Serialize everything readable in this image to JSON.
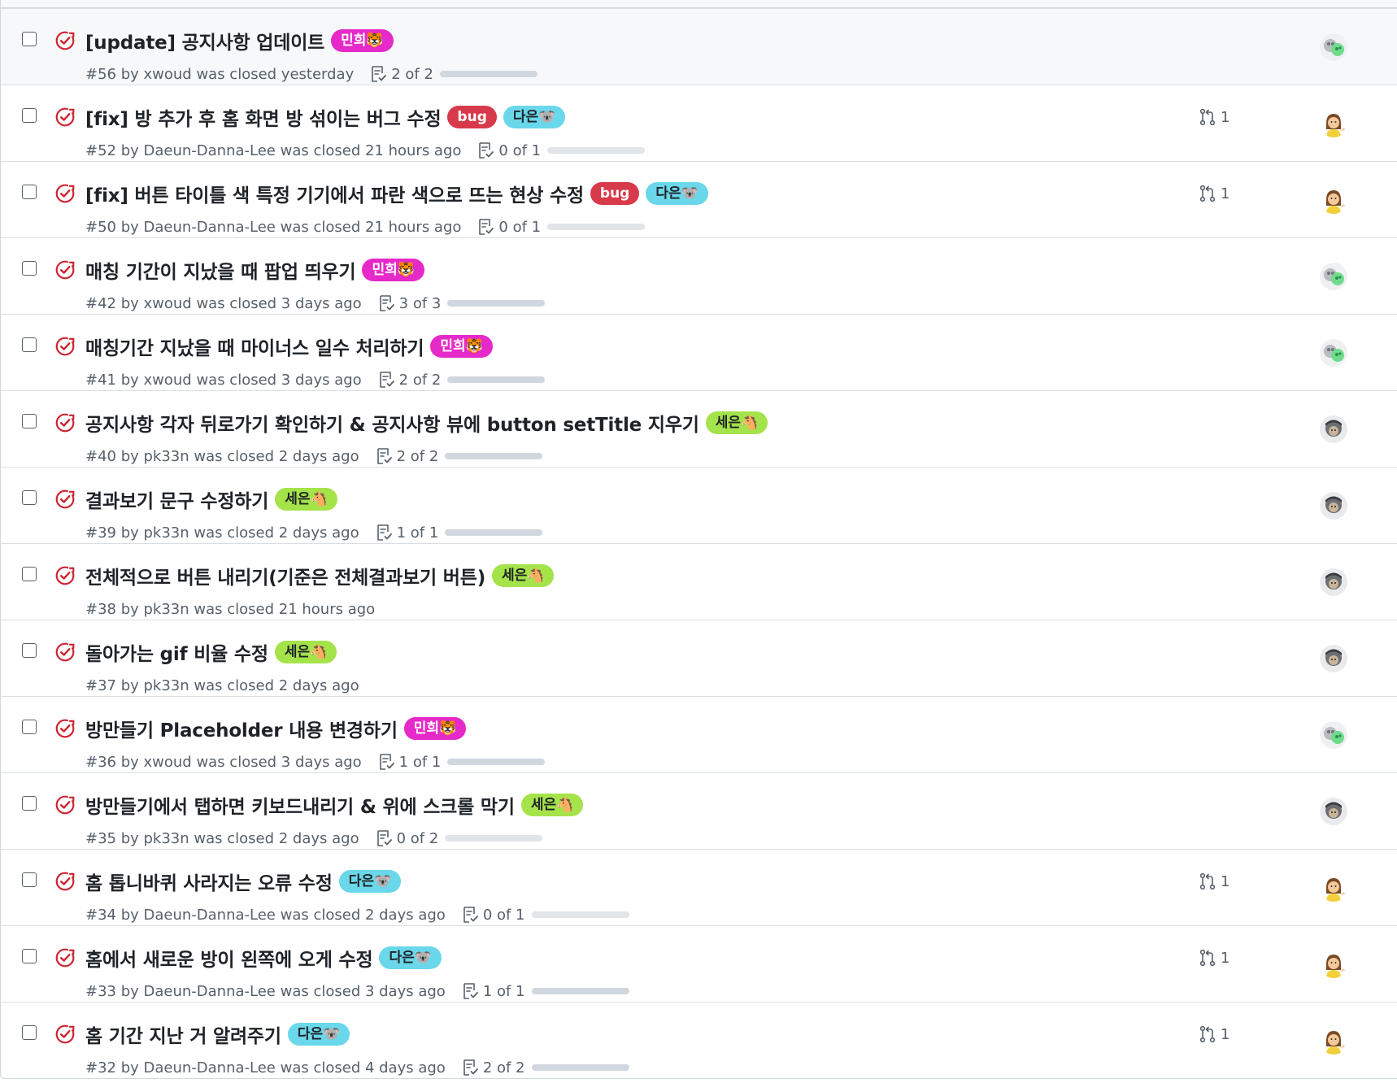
{
  "accent_closed": "#cf222e",
  "issues": [
    {
      "title": "[update] 공지사항 업데이트",
      "labels": [
        {
          "text": "민희🐯",
          "bg": "#e629c9",
          "fg": "#ffffff"
        }
      ],
      "meta": "#56 by xwoud was closed yesterday",
      "tasks": "2 of 2",
      "progress": 1.0,
      "pr": "",
      "avatar": "xwoud",
      "hovered": true
    },
    {
      "title": "[fix] 방 추가 후 홈 화면 방 섞이는 버그 수정",
      "labels": [
        {
          "text": "bug",
          "bg": "#d73a4a",
          "fg": "#ffffff"
        },
        {
          "text": "다은🐨",
          "bg": "#6ad7ea",
          "fg": "#1f2328"
        }
      ],
      "meta": "#52 by Daeun-Danna-Lee was closed 21 hours ago",
      "tasks": "0 of 1",
      "progress": 0.0,
      "pr": "1",
      "avatar": "Daeun-Danna-Lee",
      "hovered": false
    },
    {
      "title": "[fix] 버튼 타이틀 색 특정 기기에서 파란 색으로 뜨는 현상 수정",
      "labels": [
        {
          "text": "bug",
          "bg": "#d73a4a",
          "fg": "#ffffff"
        },
        {
          "text": "다은🐨",
          "bg": "#6ad7ea",
          "fg": "#1f2328"
        }
      ],
      "meta": "#50 by Daeun-Danna-Lee was closed 21 hours ago",
      "tasks": "0 of 1",
      "progress": 0.0,
      "pr": "1",
      "avatar": "Daeun-Danna-Lee",
      "hovered": false
    },
    {
      "title": "매칭 기간이 지났을 때 팝업 띄우기",
      "labels": [
        {
          "text": "민희🐯",
          "bg": "#e629c9",
          "fg": "#ffffff"
        }
      ],
      "meta": "#42 by xwoud was closed 3 days ago",
      "tasks": "3 of 3",
      "progress": 1.0,
      "pr": "",
      "avatar": "xwoud",
      "hovered": false
    },
    {
      "title": "매칭기간 지났을 때 마이너스 일수 처리하기",
      "labels": [
        {
          "text": "민희🐯",
          "bg": "#e629c9",
          "fg": "#ffffff"
        }
      ],
      "meta": "#41 by xwoud was closed 3 days ago",
      "tasks": "2 of 2",
      "progress": 1.0,
      "pr": "",
      "avatar": "xwoud",
      "hovered": false
    },
    {
      "title": "공지사항 각자 뒤로가기 확인하기 & 공지사항 뷰에 button setTitle 지우기",
      "labels": [
        {
          "text": "세은🐴",
          "bg": "#a5e34a",
          "fg": "#1f2328"
        }
      ],
      "meta": "#40 by pk33n was closed 2 days ago",
      "tasks": "2 of 2",
      "progress": 1.0,
      "pr": "",
      "avatar": "pk33n",
      "hovered": false
    },
    {
      "title": "결과보기 문구 수정하기",
      "labels": [
        {
          "text": "세은🐴",
          "bg": "#a5e34a",
          "fg": "#1f2328"
        }
      ],
      "meta": "#39 by pk33n was closed 2 days ago",
      "tasks": "1 of 1",
      "progress": 1.0,
      "pr": "",
      "avatar": "pk33n",
      "hovered": false
    },
    {
      "title": "전체적으로 버튼 내리기(기준은 전체결과보기 버튼)",
      "labels": [
        {
          "text": "세은🐴",
          "bg": "#a5e34a",
          "fg": "#1f2328"
        }
      ],
      "meta": "#38 by pk33n was closed 21 hours ago",
      "tasks": "",
      "progress": null,
      "pr": "",
      "avatar": "pk33n",
      "hovered": false
    },
    {
      "title": "돌아가는 gif 비율 수정",
      "labels": [
        {
          "text": "세은🐴",
          "bg": "#a5e34a",
          "fg": "#1f2328"
        }
      ],
      "meta": "#37 by pk33n was closed 2 days ago",
      "tasks": "",
      "progress": null,
      "pr": "",
      "avatar": "pk33n",
      "hovered": false
    },
    {
      "title": "방만들기 Placeholder 내용 변경하기",
      "labels": [
        {
          "text": "민희🐯",
          "bg": "#e629c9",
          "fg": "#ffffff"
        }
      ],
      "meta": "#36 by xwoud was closed 3 days ago",
      "tasks": "1 of 1",
      "progress": 1.0,
      "pr": "",
      "avatar": "xwoud",
      "hovered": false
    },
    {
      "title": "방만들기에서 탭하면 키보드내리기 & 위에 스크롤 막기",
      "labels": [
        {
          "text": "세은🐴",
          "bg": "#a5e34a",
          "fg": "#1f2328"
        }
      ],
      "meta": "#35 by pk33n was closed 2 days ago",
      "tasks": "0 of 2",
      "progress": 0.0,
      "pr": "",
      "avatar": "pk33n",
      "hovered": false
    },
    {
      "title": "홈 톱니바퀴 사라지는 오류 수정",
      "labels": [
        {
          "text": "다은🐨",
          "bg": "#6ad7ea",
          "fg": "#1f2328"
        }
      ],
      "meta": "#34 by Daeun-Danna-Lee was closed 2 days ago",
      "tasks": "0 of 1",
      "progress": 0.0,
      "pr": "1",
      "avatar": "Daeun-Danna-Lee",
      "hovered": false
    },
    {
      "title": "홈에서 새로운 방이 왼쪽에 오게 수정",
      "labels": [
        {
          "text": "다은🐨",
          "bg": "#6ad7ea",
          "fg": "#1f2328"
        }
      ],
      "meta": "#33 by Daeun-Danna-Lee was closed 3 days ago",
      "tasks": "1 of 1",
      "progress": 1.0,
      "pr": "1",
      "avatar": "Daeun-Danna-Lee",
      "hovered": false
    },
    {
      "title": "홈 기간 지난 거 알려주기",
      "labels": [
        {
          "text": "다은🐨",
          "bg": "#6ad7ea",
          "fg": "#1f2328"
        }
      ],
      "meta": "#32 by Daeun-Danna-Lee was closed 4 days ago",
      "tasks": "2 of 2",
      "progress": 1.0,
      "pr": "1",
      "avatar": "Daeun-Danna-Lee",
      "hovered": false
    }
  ]
}
